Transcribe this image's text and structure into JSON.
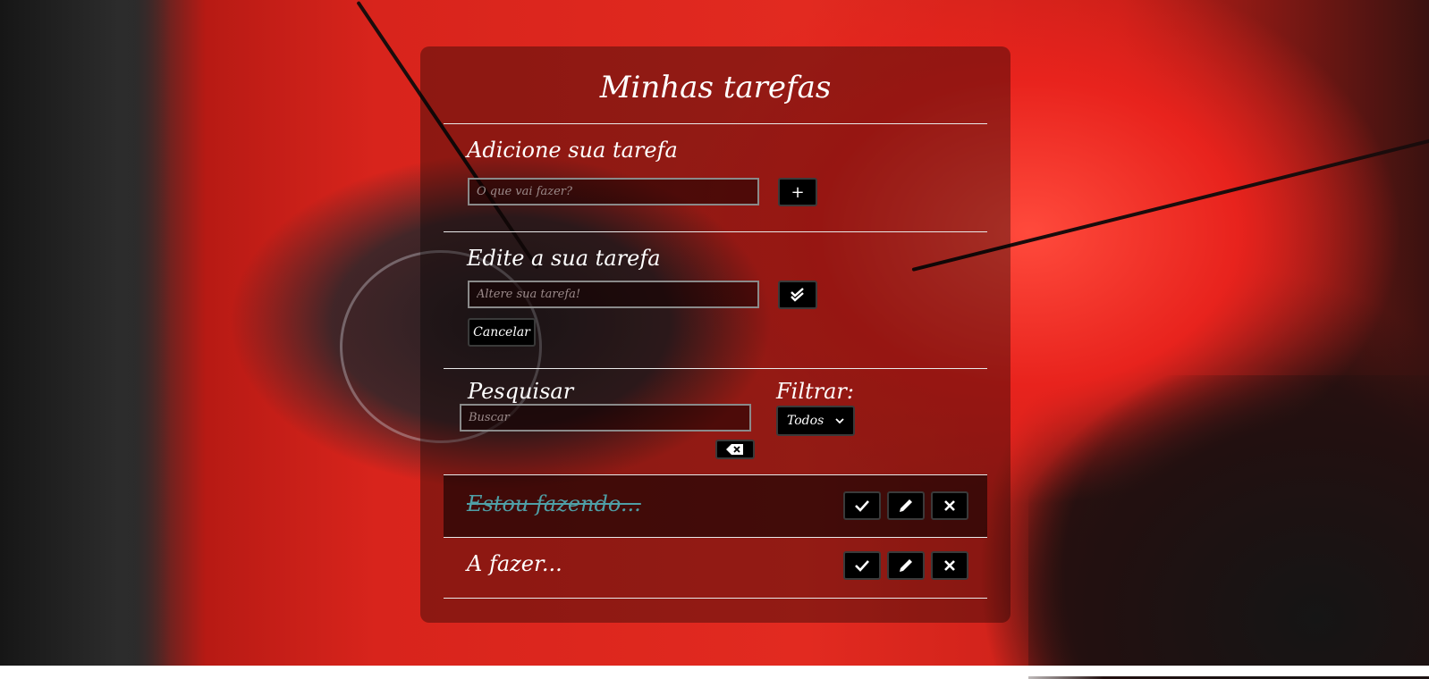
{
  "title": "Minhas tarefas",
  "add": {
    "label": "Adicione sua tarefa",
    "placeholder": "O que vai fazer?",
    "button_label": "+"
  },
  "edit": {
    "label": "Edite a sua tarefa",
    "placeholder": "Altere sua tarefa!",
    "confirm_icon": "double-check-icon",
    "cancel_label": "Cancelar"
  },
  "search": {
    "label": "Pesquisar",
    "placeholder": "Buscar",
    "clear_icon": "backspace-icon"
  },
  "filter": {
    "label": "Filtrar:",
    "selected": "Todos"
  },
  "todos": [
    {
      "text": "Estou fazendo...",
      "done": true
    },
    {
      "text": "A fazer...",
      "done": false
    }
  ],
  "colors": {
    "done_text": "#4f9fa6",
    "button_bg": "#000000",
    "card_bg": "rgba(0,0,0,0.35)"
  }
}
